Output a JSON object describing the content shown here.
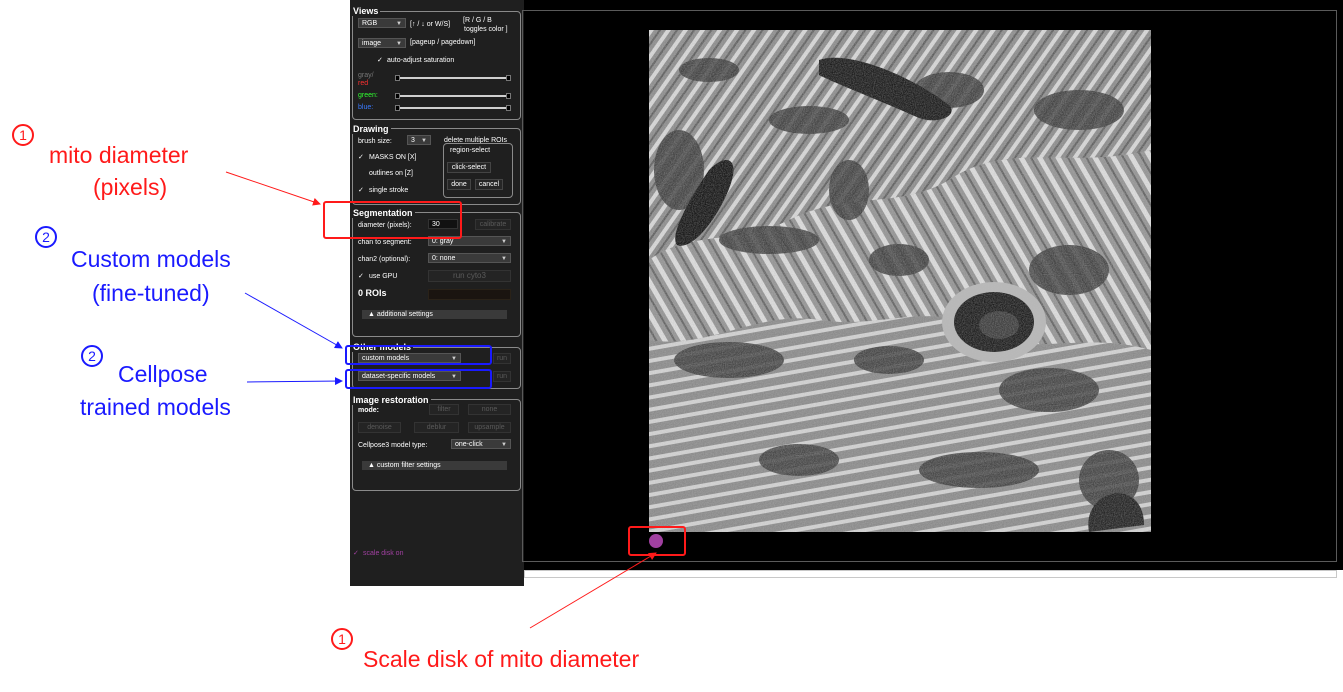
{
  "colors": {
    "annotation_red": "#ff1a1a",
    "annotation_blue": "#1a1aff",
    "panel_bg": "#1f1f1f",
    "disk": "#a040a0",
    "label_red": "#ff3030",
    "label_green": "#30ff30",
    "label_blue": "#3a7aff",
    "scale_label": "#a040a0"
  },
  "views": {
    "title": "Views",
    "color_mode": "RGB",
    "color_hint": "[↑ / ↓ or W/S]",
    "toggle_hint_1": "[R / G / B",
    "toggle_hint_2": "toggles color ]",
    "view_mode": "image",
    "view_hint": "[pageup / pagedown]",
    "auto_adjust": "auto-adjust saturation",
    "gray": "gray/",
    "red": "red",
    "green": "green:",
    "blue": "blue:"
  },
  "drawing": {
    "title": "Drawing",
    "brush_label": "brush size:",
    "brush_value": "3",
    "masks_on": "MASKS ON [X]",
    "outlines_on": "outlines on [Z]",
    "single_stroke": "single stroke",
    "delete_title": "delete multiple ROIs",
    "region_select": "region-select",
    "click_select": "click-select",
    "done": "done",
    "cancel": "cancel"
  },
  "segmentation": {
    "title": "Segmentation",
    "diameter_label": "diameter (pixels):",
    "diameter_value": "30",
    "calibrate": "calibrate",
    "chan_label": "chan to segment:",
    "chan_value": "0: gray",
    "chan2_label": "chan2 (optional):",
    "chan2_value": "0: none",
    "use_gpu": "use GPU",
    "run": "run cyto3",
    "rois": "0 ROIs",
    "additional": "▲ additional settings"
  },
  "other_models": {
    "title": "Other models",
    "custom": "custom models",
    "dataset": "dataset-specific models",
    "run": "run"
  },
  "restoration": {
    "title": "Image restoration",
    "mode_label": "mode:",
    "filter": "filter",
    "none": "none",
    "denoise": "denoise",
    "deblur": "deblur",
    "upsample": "upsample",
    "model_type_label": "Cellpose3 model type:",
    "model_type_value": "one-click",
    "custom_filter": "▲ custom filter settings"
  },
  "scale_disk_label": "scale disk on",
  "annotations": {
    "n1": "1",
    "n2": "2",
    "mito_1": "mito diameter",
    "mito_2": "(pixels)",
    "custom_1": "Custom models",
    "custom_2": "(fine-tuned)",
    "cellpose_1": "Cellpose",
    "cellpose_2": "trained models",
    "scale": "Scale disk of mito diameter"
  }
}
